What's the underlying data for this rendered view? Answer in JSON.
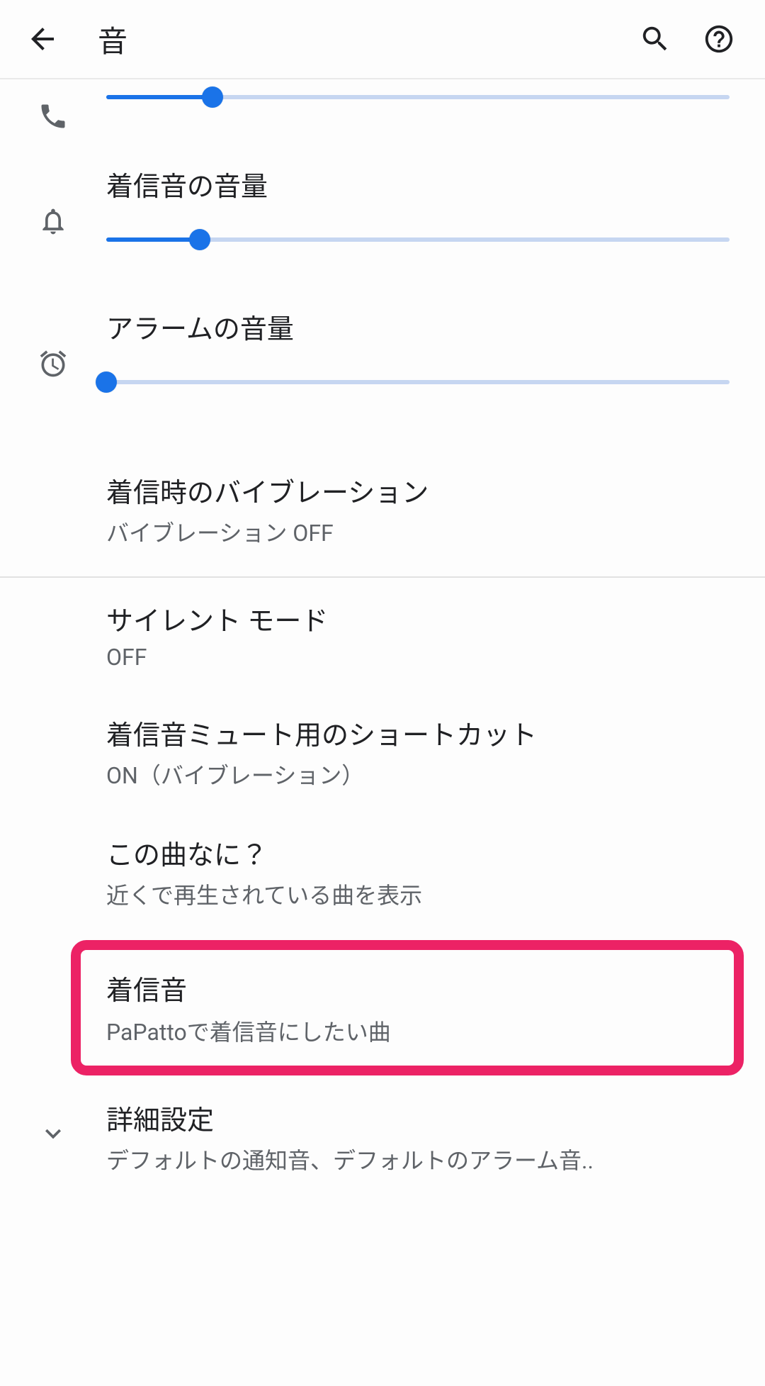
{
  "header": {
    "title": "音"
  },
  "sliders": {
    "call": {
      "percent": 17
    },
    "ring": {
      "label": "着信音の音量",
      "percent": 15
    },
    "alarm": {
      "label": "アラームの音量",
      "percent": 0
    }
  },
  "items": {
    "vibration": {
      "title": "着信時のバイブレーション",
      "sub": "バイブレーション OFF"
    },
    "silent": {
      "title": "サイレント モード",
      "sub": "OFF"
    },
    "shortcut": {
      "title": "着信音ミュート用のショートカット",
      "sub": "ON（バイブレーション）"
    },
    "nowplay": {
      "title": "この曲なに？",
      "sub": "近くで再生されている曲を表示"
    },
    "ringtone": {
      "title": "着信音",
      "sub": "PaPattoで着信音にしたい曲"
    },
    "advanced": {
      "title": "詳細設定",
      "sub": "デフォルトの通知音、デフォルトのアラーム音.."
    }
  }
}
